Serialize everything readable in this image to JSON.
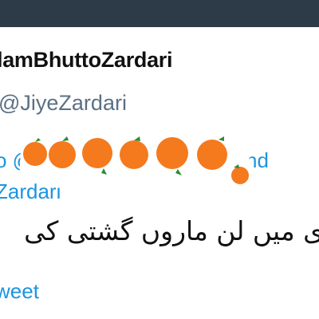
{
  "profile": {
    "display_name": "lamBhuttoZardari",
    "handle": "@JiyeZardari"
  },
  "replying_to": {
    "line1_lead": "o @",
    "line1_tail": "nd",
    "line2": "Zardari"
  },
  "tweet": {
    "text": "ی میں لن ماروں گشتی کی"
  },
  "translate_link": "weet",
  "redaction": {
    "icon": "orange-sticker",
    "colors": {
      "fruit": "#f47a1d",
      "leaf": "#2e8b3a",
      "stem": "#3b2a1a"
    }
  },
  "colors": {
    "topbar": "#2c3b47",
    "link": "#1b95e0",
    "secondary_text": "#5b7083",
    "primary_text": "#111111"
  }
}
